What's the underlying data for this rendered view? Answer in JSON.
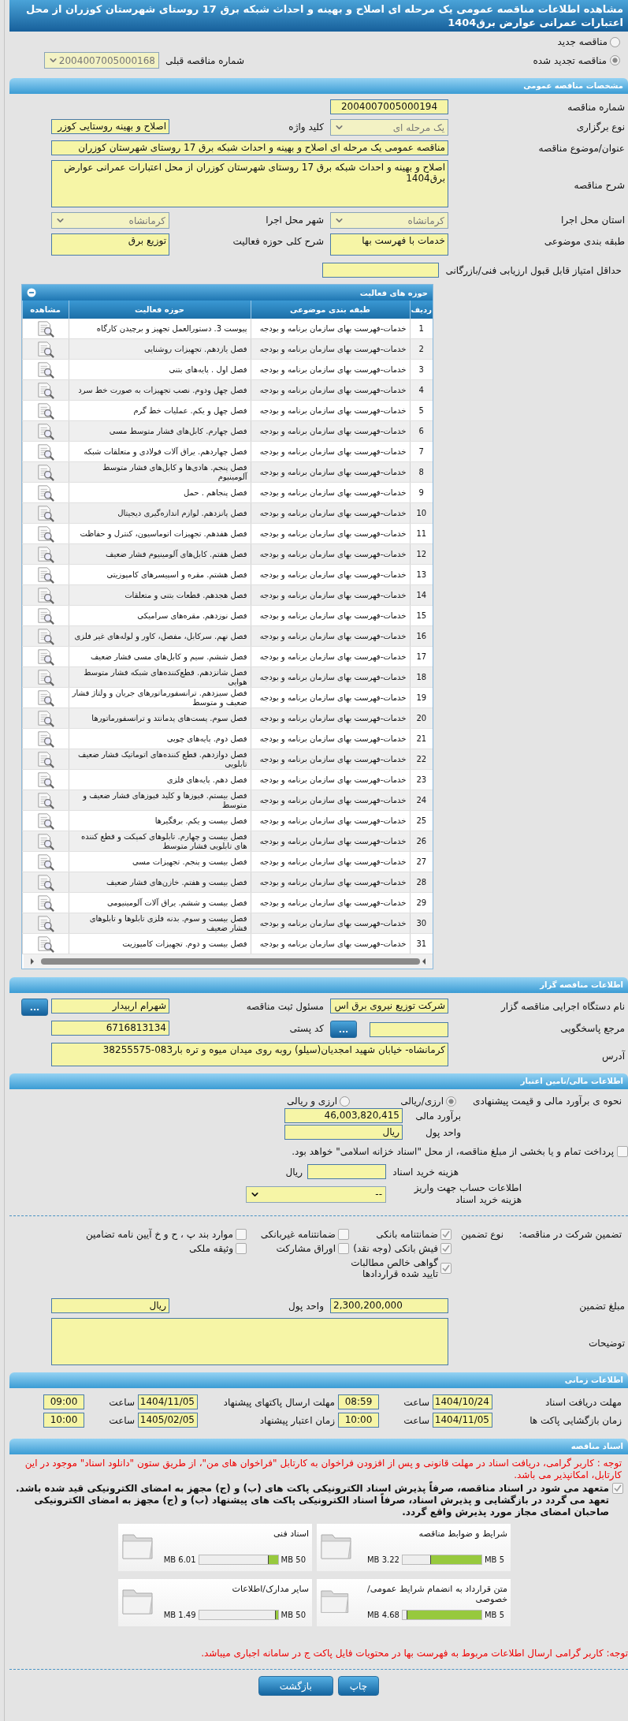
{
  "title": "مشاهده اطلاعات مناقصه عمومی یک مرحله ای اصلاح و بهینه و احداث شبکه برق 17 روستای شهرستان کوزران از محل اعتبارات عمرانی عوارض برق1404",
  "tender_type": [
    {
      "label": "مناقصه جدید",
      "selected": false
    },
    {
      "label": "مناقصه تجدید شده",
      "selected": true
    }
  ],
  "previous_tender": {
    "label": "شماره مناقصه قبلی",
    "value": "2004007005000168"
  },
  "general": {
    "title": "مشخصات مناقصه عمومی",
    "tender_number": {
      "label": "شماره مناقصه",
      "value": "2004007005000194"
    },
    "holding_type": {
      "label": "نوع برگزاری",
      "value": "یک مرحله ای"
    },
    "keyword": {
      "label": "کلید واژه",
      "value": "اصلاح و بهینه روستایی کوزر"
    },
    "subject": {
      "label": "عنوان/موضوع مناقصه",
      "value": "مناقصه عمومی یک مرحله ای اصلاح و بهینه و احداث شبکه برق 17 روستای شهرستان کوزران"
    },
    "description": {
      "label": "شرح مناقصه",
      "value": "اصلاح و بهینه و احداث شبکه برق 17 روستای شهرستان کوزران از محل اعتبارات عمرانی عوارض برق1404"
    },
    "province": {
      "label": "استان محل اجرا",
      "value": "کرمانشاه"
    },
    "city": {
      "label": "شهر محل اجرا",
      "value": "کرمانشاه"
    },
    "category": {
      "label": "طبقه بندی موضوعی",
      "value": "خدمات با فهرست بها"
    },
    "activity_scope": {
      "label": "شرح کلی حوزه فعالیت",
      "value": "توزیع برق"
    },
    "min_score": {
      "label": "حداقل امتیاز قابل قبول ارزیابی فنی/بازرگانی"
    }
  },
  "activities": {
    "title": "حوزه های فعالیت",
    "expanded": true,
    "columns": [
      "ردیف",
      "طبقه بندی موضوعی",
      "حوزه فعالیت",
      "مشاهده"
    ],
    "rows": [
      {
        "index": "1",
        "category": "خدمات-فهرست بهای سازمان برنامه و بودجه",
        "activity": "پیوست 3. دستورالعمل تجهیز و برچیدن کارگاه"
      },
      {
        "index": "2",
        "category": "خدمات-فهرست بهای سازمان برنامه و بودجه",
        "activity": "فصل یازدهم. تجهیزات روشنایی"
      },
      {
        "index": "3",
        "category": "خدمات-فهرست بهای سازمان برنامه و بودجه",
        "activity": "فصل اول . پایه‌های بتنی"
      },
      {
        "index": "4",
        "category": "خدمات-فهرست بهای سازمان برنامه و بودجه",
        "activity": "فصل چهل ودوم. نصب تجهیزات به صورت خط سرد"
      },
      {
        "index": "5",
        "category": "خدمات-فهرست بهای سازمان برنامه و بودجه",
        "activity": "فصل چهل و یکم. عملیات خط گرم"
      },
      {
        "index": "6",
        "category": "خدمات-فهرست بهای سازمان برنامه و بودجه",
        "activity": "فصل چهارم. کابل‌های فشار متوسط مسی"
      },
      {
        "index": "7",
        "category": "خدمات-فهرست بهای سازمان برنامه و بودجه",
        "activity": "فصل چهاردهم. یراق آلات فولادی و متعلقات شبکه"
      },
      {
        "index": "8",
        "category": "خدمات-فهرست بهای سازمان برنامه و بودجه",
        "activity": "فصل پنجم. هادی‌ها و کابل‌های فشار متوسط آلومینیوم"
      },
      {
        "index": "9",
        "category": "خدمات-فهرست بهای سازمان برنامه و بودجه",
        "activity": "فصل پنجاهم . حمل"
      },
      {
        "index": "10",
        "category": "خدمات-فهرست بهای سازمان برنامه و بودجه",
        "activity": "فصل پانزدهم. لوازم اندازه‌گیری دیجیتال"
      },
      {
        "index": "11",
        "category": "خدمات-فهرست بهای سازمان برنامه و بودجه",
        "activity": "فصل هفدهم. تجهیزات اتوماسیون، کنترل و حفاظت"
      },
      {
        "index": "12",
        "category": "خدمات-فهرست بهای سازمان برنامه و بودجه",
        "activity": "فصل هفتم. کابل‌های آلومینیوم فشار ضعیف"
      },
      {
        "index": "13",
        "category": "خدمات-فهرست بهای سازمان برنامه و بودجه",
        "activity": "فصل هشتم. مقره و اسپیسرهای کامپوزیتی"
      },
      {
        "index": "14",
        "category": "خدمات-فهرست بهای سازمان برنامه و بودجه",
        "activity": "فصل هجدهم. قطعات بتنی و متعلقات"
      },
      {
        "index": "15",
        "category": "خدمات-فهرست بهای سازمان برنامه و بودجه",
        "activity": "فصل نوزدهم. مقره‌های سرامیکی"
      },
      {
        "index": "16",
        "category": "خدمات-فهرست بهای سازمان برنامه و بودجه",
        "activity": "فصل نهم. سرکابل، مفصل، کاور و لوله‌های غیر فلزی"
      },
      {
        "index": "17",
        "category": "خدمات-فهرست بهای سازمان برنامه و بودجه",
        "activity": "فصل ششم. سیم و کابل‌های مسی فشار ضعیف"
      },
      {
        "index": "18",
        "category": "خدمات-فهرست بهای سازمان برنامه و بودجه",
        "activity": "فصل شانزدهم. قطع‌کننده‌های شبکه فشار متوسط هوایی"
      },
      {
        "index": "19",
        "category": "خدمات-فهرست بهای سازمان برنامه و بودجه",
        "activity": "فصل سیزدهم. ترانسفورماتورهای جریان و ولتاژ فشار ضعیف و متوسط"
      },
      {
        "index": "20",
        "category": "خدمات-فهرست بهای سازمان برنامه و بودجه",
        "activity": "فصل سوم. پست‌های پدمانتد و ترانسفورماتورها"
      },
      {
        "index": "21",
        "category": "خدمات-فهرست بهای سازمان برنامه و بودجه",
        "activity": "فصل دوم. پایه‌های چوبی"
      },
      {
        "index": "22",
        "category": "خدمات-فهرست بهای سازمان برنامه و بودجه",
        "activity": "فصل دوازدهم. قطع کننده‌های اتوماتیک فشار ضعیف تابلویی"
      },
      {
        "index": "23",
        "category": "خدمات-فهرست بهای سازمان برنامه و بودجه",
        "activity": "فصل دهم. پایه‌های فلزی"
      },
      {
        "index": "24",
        "category": "خدمات-فهرست بهای سازمان برنامه و بودجه",
        "activity": "فصل بیستم. فیوزها و کلید فیوزهای فشار ضعیف و متوسط"
      },
      {
        "index": "25",
        "category": "خدمات-فهرست بهای سازمان برنامه و بودجه",
        "activity": "فصل بیست و یکم. برقگیرها"
      },
      {
        "index": "26",
        "category": "خدمات-فهرست بهای سازمان برنامه و بودجه",
        "activity": "فصل بیست و چهارم. تابلوهای کمپکت و قطع کننده های تابلویی فشار متوسط"
      },
      {
        "index": "27",
        "category": "خدمات-فهرست بهای سازمان برنامه و بودجه",
        "activity": "فصل بیست و پنجم. تجهیزات مسی"
      },
      {
        "index": "28",
        "category": "خدمات-فهرست بهای سازمان برنامه و بودجه",
        "activity": "فصل بیست و هفتم. خازن‌های فشار ضعیف"
      },
      {
        "index": "29",
        "category": "خدمات-فهرست بهای سازمان برنامه و بودجه",
        "activity": "فصل بیست و ششم. یراق آلات آلومینیومی"
      },
      {
        "index": "30",
        "category": "خدمات-فهرست بهای سازمان برنامه و بودجه",
        "activity": "فصل بیست و سوم. بدنه فلزی تابلوها و تابلوهای فشار ضعیف"
      },
      {
        "index": "31",
        "category": "خدمات-فهرست بهای سازمان برنامه و بودجه",
        "activity": "فصل بیست و دوم. تجهیزات کامپوزیت"
      }
    ]
  },
  "organizer": {
    "title": "اطلاعات مناقصه گزار",
    "agency": {
      "label": "نام دستگاه اجرایی مناقصه گزار",
      "value": "شرکت توزیع نیروی برق اس"
    },
    "registrar": {
      "label": "مسئول ثبت مناقصه",
      "value": "شهرام اربیدار",
      "button": "..."
    },
    "reference": {
      "label": "مرجع پاسخگویی",
      "button": "..."
    },
    "postal_code": {
      "label": "کد پستی",
      "value": "6716813134"
    },
    "address": {
      "label": "آدرس",
      "value": "کرمانشاه- خیابان شهید امجدیان(سیلو) روبه روی میدان میوه و تره بار083-38255575"
    }
  },
  "financial": {
    "title": "اطلاعات مالی/تامین اعتبار",
    "pricing": {
      "label": "نحوه ی برآورد مالی و قیمت پیشنهادی",
      "options": [
        {
          "label": "ارزی/ریالی",
          "selected": true
        },
        {
          "label": "ارزی و ریالی",
          "selected": false
        }
      ]
    },
    "estimate": {
      "label": "برآورد مالی",
      "value": "46,003,820,415"
    },
    "currency": {
      "label": "واحد پول",
      "value": "ریال"
    },
    "treasury": {
      "label": "پرداخت تمام و یا بخشی از مبلغ مناقصه، از محل \"اسناد خزانه اسلامی\" خواهد بود.",
      "checked": false
    },
    "doc_fee": {
      "label": "هزینه خرید اسناد",
      "unit": "ریال"
    },
    "account": {
      "label": "اطلاعات حساب جهت واریز هزینه خرید اسناد",
      "value": "--"
    }
  },
  "guarantee": {
    "label": "تضمین شرکت در مناقصه:",
    "type_label": "نوع تضمین",
    "options": [
      {
        "label": "ضمانتنامه بانکی",
        "checked": true
      },
      {
        "label": "ضمانتنامه غیربانکی",
        "checked": false
      },
      {
        "label": "موارد بند پ ، ح و خ آیین نامه تضامین",
        "checked": false
      },
      {
        "label": "فیش بانکی (وجه نقد)",
        "checked": true
      },
      {
        "label": "اوراق مشارکت",
        "checked": false
      },
      {
        "label": "وثیقه ملکی",
        "checked": false
      },
      {
        "label": "گواهی خالص مطالبات تایید شده قراردادها",
        "checked": true
      }
    ],
    "amount": {
      "label": "مبلغ تضمین",
      "value": "2,300,200,000"
    },
    "currency": {
      "label": "واحد پول",
      "value": "ریال"
    },
    "notes": {
      "label": "توضیحات"
    }
  },
  "timing": {
    "title": "اطلاعات زمانی",
    "items": [
      {
        "label": "مهلت دریافت اسناد",
        "date": "1404/10/24",
        "time_label": "ساعت",
        "time": "08:59"
      },
      {
        "label": "مهلت ارسال پاکتهای پیشنهاد",
        "date": "1404/11/05",
        "time_label": "ساعت",
        "time": "09:00"
      },
      {
        "label": "زمان بازگشایی پاکت ها",
        "date": "1404/11/05",
        "time_label": "ساعت",
        "time": "10:00"
      },
      {
        "label": "زمان اعتبار پیشنهاد",
        "date": "1405/02/05",
        "time_label": "ساعت",
        "time": "10:00"
      }
    ]
  },
  "documents": {
    "title": "اسناد مناقصه",
    "notice": "توجه : کاربر گرامی، دریافت اسناد در مهلت قانونی و پس از افزودن فراخوان به کارتابل \"فراخوان های من\"، از طریق ستون \"دانلود اسناد\" موجود در این کارتابل، امکانپذیر می باشد.",
    "commitment": {
      "text": "متعهد می شود در اسناد مناقصه، صرفاً پذیرش اسناد الکترونیکی پاکت های (ب) و (ج) مجهز به امضای الکترونیکی قید شده باشد. تعهد می گردد در بازگشایی و پذیرش اسناد، صرفاً اسناد الکترونیکی پاکت های پیشنهاد (ب) و (ج) مجهز به امضای الکترونیکی صاحبان امضای مجاز مورد پذیرش واقع گردد.",
      "checked": true
    },
    "files": [
      {
        "name": "شرایط و ضوابط مناقصه",
        "size": "3.22 MB",
        "max": "5 MB",
        "level": 0.644
      },
      {
        "name": "اسناد فنی",
        "size": "6.01 MB",
        "max": "50 MB",
        "level": 0.12
      },
      {
        "name": "متن قرارداد به انضمام شرایط عمومی/خصوصی",
        "size": "4.68 MB",
        "max": "5 MB",
        "level": 0.936
      },
      {
        "name": "سایر مدارک/اطلاعات",
        "size": "1.49 MB",
        "max": "50 MB",
        "level": 0.03
      }
    ],
    "footer_note": "توجه: کاربر گرامی ارسال اطلاعات مربوط به فهرست بها در محتویات فایل پاکت ج در سامانه اجباری میباشد."
  },
  "buttons": [
    "چاپ",
    "بازگشت"
  ]
}
